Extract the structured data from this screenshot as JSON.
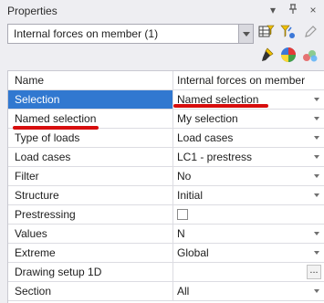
{
  "panel": {
    "title": "Properties",
    "pin_icon": "pin-icon",
    "close_glyph": "×",
    "dropdown_glyph": "▾"
  },
  "selector": {
    "value": "Internal forces on member (1)"
  },
  "toolbar": {
    "icons": [
      "filter-table-icon",
      "filter-yellow-icon",
      "pencil-icon",
      "brush-icon",
      "color-wheel-icon",
      "multi-select-icon"
    ]
  },
  "properties": [
    {
      "name": "Name",
      "value": "Internal forces on member",
      "control": "text"
    },
    {
      "name": "Selection",
      "value": "Named selection",
      "control": "dropdown",
      "selected": true
    },
    {
      "name": "Named selection",
      "value": "My selection",
      "control": "dropdown"
    },
    {
      "name": "Type of loads",
      "value": "Load cases",
      "control": "dropdown"
    },
    {
      "name": "Load cases",
      "value": "LC1 - prestress",
      "control": "dropdown"
    },
    {
      "name": "Filter",
      "value": "No",
      "control": "dropdown"
    },
    {
      "name": "Structure",
      "value": "Initial",
      "control": "dropdown"
    },
    {
      "name": "Prestressing",
      "value": "",
      "control": "checkbox",
      "checked": false
    },
    {
      "name": "Values",
      "value": "N",
      "control": "dropdown"
    },
    {
      "name": "Extreme",
      "value": "Global",
      "control": "dropdown"
    },
    {
      "name": "Drawing setup 1D",
      "value": "",
      "control": "ellipsis",
      "button_label": "..."
    },
    {
      "name": "Section",
      "value": "All",
      "control": "dropdown"
    }
  ],
  "annotations": {
    "highlight_color": "#d70d0d",
    "underlined": [
      "Named selection (value)",
      "Named selection (name)"
    ]
  }
}
